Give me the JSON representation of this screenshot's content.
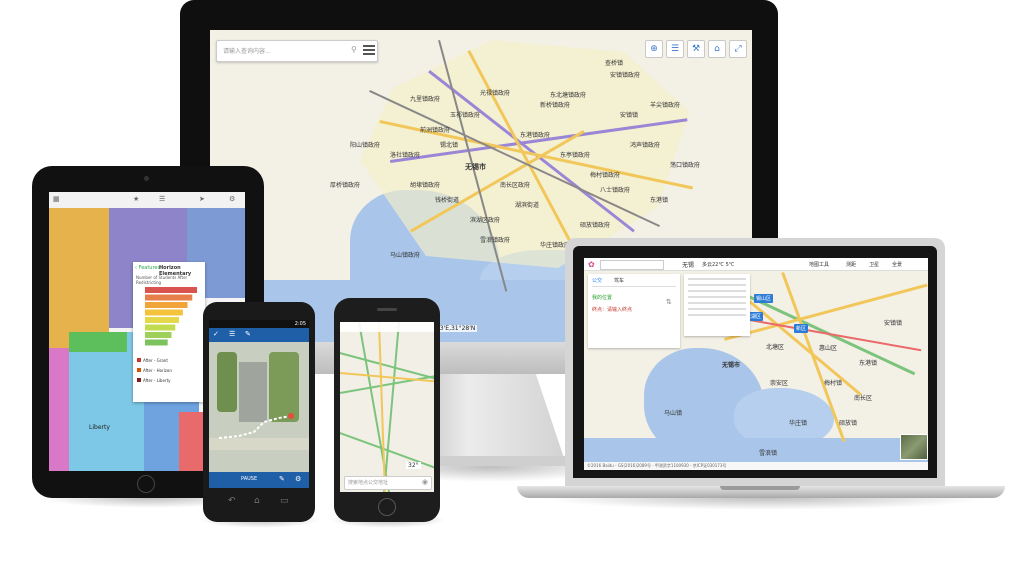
{
  "monitor": {
    "search": {
      "placeholder": "请输入查询内容..."
    },
    "toolbar": {
      "icons": [
        "locate-icon",
        "layers-icon",
        "tools-icon",
        "home-icon",
        "fullscreen-icon"
      ]
    },
    "coord_readout": "100°18.43'E,31°28'N",
    "map_labels": [
      "九里镇政府",
      "光禄镇政府",
      "玉祁镇政府",
      "前洲镇政府",
      "洛社镇政府",
      "新桥镇政府",
      "安镇镇政府",
      "鸿声镇政府",
      "东亭镇政府",
      "梅村镇政府",
      "八士镇政府",
      "东港镇政府",
      "锡北镇",
      "厚桥镇政府",
      "胡埭镇政府",
      "马山镇政府",
      "滨湖区政府",
      "南长区政府",
      "无锡市",
      "湖滨街道",
      "硕放镇政府",
      "雪浪镇政府",
      "华庄镇政府",
      "钱桥街道",
      "阳山镇政府",
      "东北塘镇政府",
      "羊尖镇政府",
      "荡口镇政府",
      "安镇镇",
      "东港镇",
      "查桥镇"
    ]
  },
  "laptop": {
    "tabs": [
      "公交",
      "驾车"
    ],
    "from_label": "我的位置",
    "to_label": "终点：请输入终点",
    "city": "无锡",
    "weather": "多云22℃ 5℃",
    "toolbar": [
      "地图工具",
      "测距",
      "卫星",
      "全景"
    ],
    "map_labels": [
      "无锡市",
      "梅村镇",
      "马山镇",
      "雪浪镇",
      "华庄镇",
      "硕放镇",
      "东港镇",
      "安镇镇",
      "新区",
      "滨湖区",
      "锡山区",
      "惠山区",
      "北塘区",
      "南长区",
      "崇安区"
    ],
    "footer": "©2016 Baidu - GS(2016)2089号 - 甲测资字1100930 - 京ICP证030173号"
  },
  "tablet": {
    "back_label": "Features",
    "title": "Horizon Elementary",
    "subtitle": "Number of Students After Redistricting",
    "legend": [
      {
        "label": "After - Grant",
        "color": "#c0392b"
      },
      {
        "label": "After - Horizon",
        "color": "#d35400"
      },
      {
        "label": "After - Liberty",
        "color": "#7f1d1d"
      }
    ],
    "map_label": "Liberty",
    "bar_chart": {
      "type": "bar",
      "values": [
        55,
        50,
        45,
        40,
        36,
        32,
        28,
        24
      ],
      "colors": [
        "#d9534f",
        "#e77f4a",
        "#f0a43a",
        "#f5c33b",
        "#e5d84a",
        "#c3dc4f",
        "#9ed05a",
        "#7cc35e"
      ]
    }
  },
  "phone1": {
    "status_time": "2:05",
    "bottom_label": "PAUSE"
  },
  "phone2": {
    "search_placeholder": "搜索地点公交地址",
    "temp": "32°"
  }
}
